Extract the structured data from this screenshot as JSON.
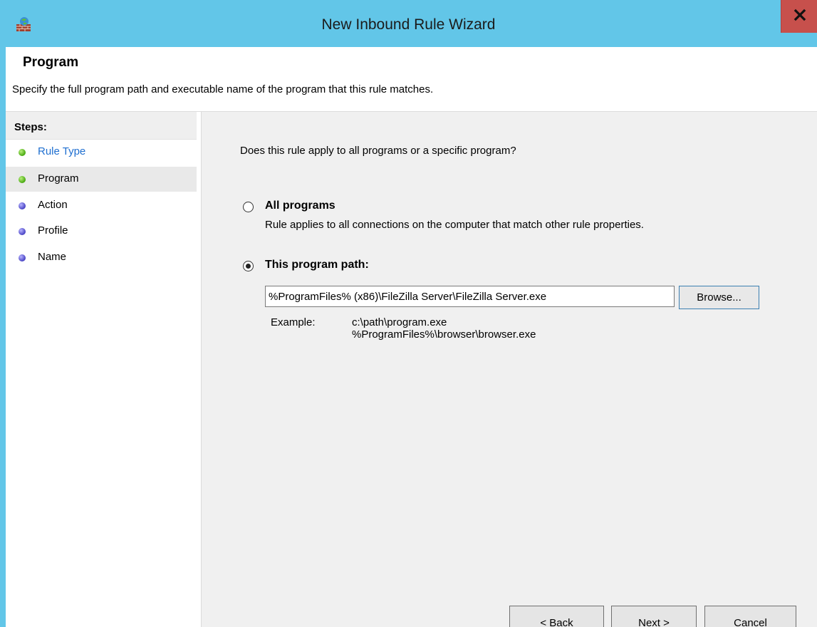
{
  "window": {
    "title": "New Inbound Rule Wizard",
    "close_label": "x"
  },
  "header": {
    "title": "Program",
    "description": "Specify the full program path and executable name of the program that this rule matches."
  },
  "sidebar": {
    "steps_title": "Steps:",
    "steps": [
      {
        "label": "Rule Type",
        "status": "done",
        "dot_color": "#47a80f"
      },
      {
        "label": "Program",
        "status": "current",
        "dot_color": "#47a80f"
      },
      {
        "label": "Action",
        "status": "pending",
        "dot_color": "#4843c4"
      },
      {
        "label": "Profile",
        "status": "pending",
        "dot_color": "#4843c4"
      },
      {
        "label": "Name",
        "status": "pending",
        "dot_color": "#4843c4"
      }
    ]
  },
  "main": {
    "question": "Does this rule apply to all programs or a specific program?",
    "all_programs": {
      "label": "All programs",
      "description": "Rule applies to all connections on the computer that match other rule properties.",
      "selected": false
    },
    "program_path": {
      "label": "This program path:",
      "selected": true,
      "value": "%ProgramFiles% (x86)\\FileZilla Server\\FileZilla Server.exe",
      "browse_label": "Browse..."
    },
    "example": {
      "label": "Example:",
      "line1": "c:\\path\\program.exe",
      "line2": "%ProgramFiles%\\browser\\browser.exe"
    }
  },
  "footer": {
    "back_label": "< Back",
    "next_label": "Next >",
    "cancel_label": "Cancel"
  },
  "colors": {
    "titlebar": "#62c6e8",
    "close_button": "#c7504c",
    "link": "#1f6fd0"
  }
}
